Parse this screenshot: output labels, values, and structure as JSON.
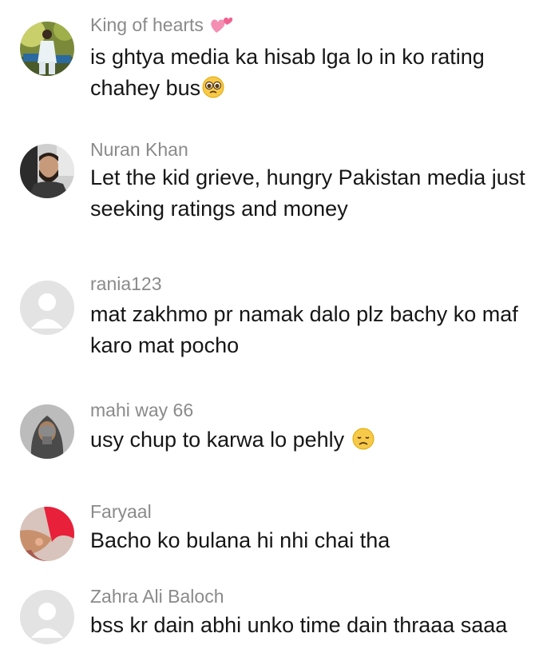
{
  "comments": [
    {
      "username": "King of hearts",
      "username_emoji": "pink-hearts-icon",
      "text": "is ghtya media ka hisab lga lo in ko rating chahey bus",
      "text_emoji": "pleading-face-icon",
      "avatar": "photo-man-in-white-outfit"
    },
    {
      "username": "Nuran Khan",
      "text": "Let the kid grieve, hungry Pakistan media just seeking ratings and money",
      "avatar": "photo-bearded-man-in-car"
    },
    {
      "username": "rania123",
      "text": "mat zakhmo pr namak dalo plz bachy ko maf karo mat pocho",
      "avatar": "default-avatar"
    },
    {
      "username": "mahi way 66",
      "text": "usy chup to karwa lo pehly",
      "text_emoji": "disappointed-face-icon",
      "avatar": "photo-woman-in-hijab"
    },
    {
      "username": "Faryaal",
      "text": "Bacho ko bulana hi nhi chai tha",
      "avatar": "photo-hand-with-red-cloth"
    },
    {
      "username": "Zahra Ali Baloch",
      "text": "bss kr dain abhi unko time dain thraaa saaa",
      "avatar": "default-avatar"
    }
  ],
  "colors": {
    "username": "#8a8a8a",
    "text": "#161616",
    "default_avatar_bg": "#e3e3e3",
    "default_avatar_fg": "#ffffff"
  }
}
